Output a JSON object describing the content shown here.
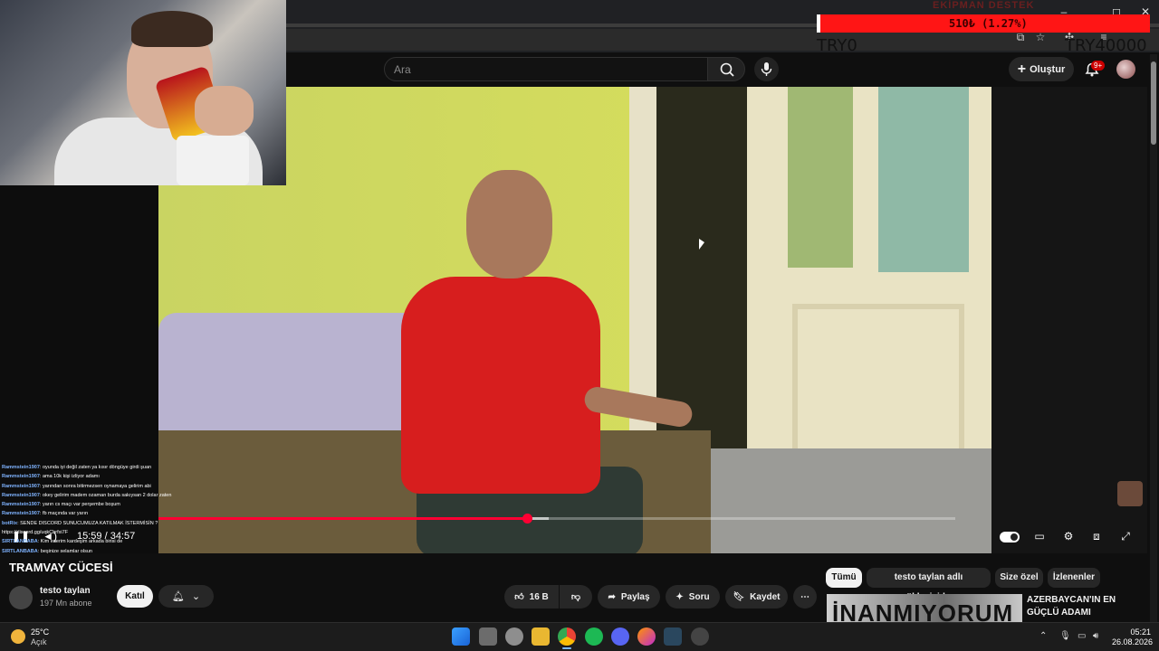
{
  "overlay": {
    "donation_title": "EKİPMAN DESTEK",
    "donation_progress_text": "510₺ (1.27%)",
    "donation_start_label": "TRY0",
    "donation_goal_label": "TRY40000"
  },
  "window_controls": {
    "minimize": "–",
    "maximize": "◻",
    "close": "✕"
  },
  "header": {
    "search_placeholder": "Ara",
    "create_label": "Oluştur",
    "notifications_badge": "9+"
  },
  "player": {
    "time_display": "15:59 / 34:57",
    "progress_fraction": 0.462,
    "buffer_fraction": 0.49
  },
  "chat": [
    {
      "user": "Rammstein1907",
      "text": ": oyunda iyi değil zaten ya kısır döngüye girdi şuan"
    },
    {
      "user": "Rammstein1907",
      "text": ": ama 10k kişi izliyor adamı"
    },
    {
      "user": "Rammstein1907",
      "text": ": yarından sonra bitirmezsen oynamaya gelirim abi"
    },
    {
      "user": "Rammstein1907",
      "text": ": okey gelirim madem ozaman burda sakıysan 2 dolar zaten"
    },
    {
      "user": "Rammstein1907",
      "text": ": yarın cs maçı var perşembe boşum"
    },
    {
      "user": "Rammstein1907",
      "text": ": fb maçında var yarın"
    },
    {
      "user": "botRix",
      "text": ": SENDE DISCORD SUNUCUMUZA KATILMAK İSTERMİSİN ?"
    },
    {
      "user": "",
      "text": "https://discord.gg/uqkCbrfxi7F"
    },
    {
      "user": "",
      "text": ""
    },
    {
      "user": "SIRTLANBABA",
      "text": ": Kim ederim kardeşim arkada birisi de"
    },
    {
      "user": "",
      "text": ""
    },
    {
      "user": "SIRTLANBABA",
      "text": ": beşinize selamlar olsun"
    }
  ],
  "video": {
    "title": "TRAMVAY CÜCESİ",
    "channel": "testo taylan",
    "subscribers": "197 Mn abone",
    "join_label": "Katıl",
    "likes": "16 B",
    "share_label": "Paylaş",
    "ask_label": "Soru",
    "save_label": "Kaydet"
  },
  "chips": [
    "Tümü",
    "testo taylan adlı yükleyiciden",
    "Size özel",
    "İzlenenler"
  ],
  "recommendation": {
    "thumb_text": "İNANMIYORUM",
    "title": "AZERBAYCAN'IN EN GÜÇLÜ ADAMI"
  },
  "taskbar": {
    "temperature": "25°C",
    "weather_desc": "Açık",
    "time": "05:21",
    "date": "26.08.2026"
  }
}
